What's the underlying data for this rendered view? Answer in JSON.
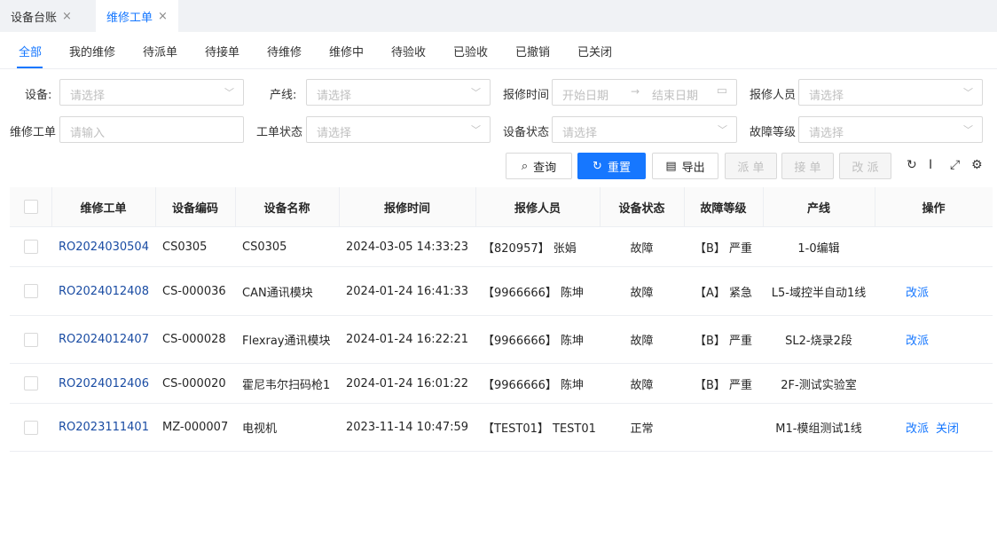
{
  "tabs": [
    {
      "label": "设备台账",
      "close": "×",
      "active": false
    },
    {
      "label": "维修工单",
      "close": "×",
      "active": true
    }
  ],
  "status_tabs": [
    "全部",
    "我的维修",
    "待派单",
    "待接单",
    "待维修",
    "维修中",
    "待验收",
    "已验收",
    "已撤销",
    "已关闭"
  ],
  "filters": {
    "device": {
      "label": "设备:",
      "placeholder": "请选择"
    },
    "line": {
      "label": "产线:",
      "placeholder": "请选择"
    },
    "report_time": {
      "label": "报修时间",
      "start": "开始日期",
      "end": "结束日期"
    },
    "reporter": {
      "label": "报修人员",
      "placeholder": "请选择"
    },
    "work_order": {
      "label": "维修工单",
      "placeholder": "请输入"
    },
    "order_status": {
      "label": "工单状态",
      "placeholder": "请选择"
    },
    "device_status": {
      "label": "设备状态",
      "placeholder": "请选择"
    },
    "fault_level": {
      "label": "故障等级",
      "placeholder": "请选择"
    }
  },
  "toolbar": {
    "query": "查询",
    "reset": "重置",
    "export": "导出",
    "dispatch": "派 单",
    "accept": "接 单",
    "reassign": "改 派"
  },
  "table": {
    "headers": [
      "维修工单",
      "设备编码",
      "设备名称",
      "报修时间",
      "报修人员",
      "设备状态",
      "故障等级",
      "产线",
      "操作"
    ],
    "rows": [
      {
        "order": "RO2024030504",
        "code": "CS0305",
        "name": "CS0305",
        "time": "2024-03-05 14:33:23",
        "reporter": "【820957】 张娟",
        "status": "故障",
        "level": "【B】 严重",
        "line": "1-0编辑",
        "op1": "",
        "op2": ""
      },
      {
        "order": "RO2024012408",
        "code": "CS-000036",
        "name": "CAN通讯模块",
        "time": "2024-01-24 16:41:33",
        "reporter": "【9966666】 陈坤",
        "status": "故障",
        "level": "【A】 紧急",
        "line": "L5-域控半自动1线",
        "op1": "改派",
        "op2": ""
      },
      {
        "order": "RO2024012407",
        "code": "CS-000028",
        "name": "Flexray通讯模块",
        "time": "2024-01-24 16:22:21",
        "reporter": "【9966666】 陈坤",
        "status": "故障",
        "level": "【B】 严重",
        "line": "SL2-烧录2段",
        "op1": "改派",
        "op2": ""
      },
      {
        "order": "RO2024012406",
        "code": "CS-000020",
        "name": "霍尼韦尔扫码枪1",
        "time": "2024-01-24 16:01:22",
        "reporter": "【9966666】 陈坤",
        "status": "故障",
        "level": "【B】 严重",
        "line": "2F-测试实验室",
        "op1": "",
        "op2": ""
      },
      {
        "order": "RO2023111401",
        "code": "MZ-000007",
        "name": "电视机",
        "time": "2023-11-14 10:47:59",
        "reporter": "【TEST01】 TEST01",
        "status": "正常",
        "level": "",
        "line": "M1-模组测试1线",
        "op1": "改派",
        "op2": "关闭"
      }
    ]
  },
  "icons": {
    "refresh": "refresh-icon",
    "column_height": "column-height-icon",
    "fullscreen": "fullscreen-icon",
    "settings": "settings-icon"
  },
  "colors": {
    "accent": "#1677ff",
    "link": "#1a4ca3"
  }
}
